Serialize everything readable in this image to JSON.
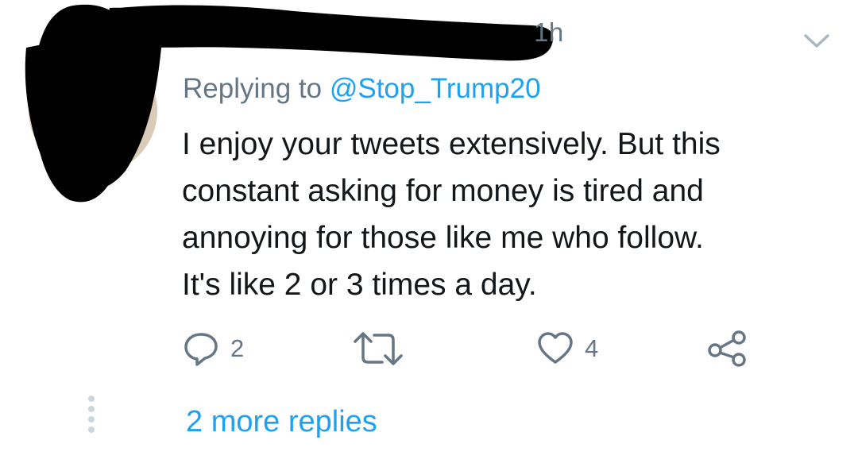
{
  "tweet": {
    "timestamp": "1h",
    "reply_prefix": "Replying to ",
    "reply_handle": "@Stop_Trump20",
    "body_lines": [
      "I enjoy your tweets extensively. But this",
      "constant asking for money is tired and",
      "annoying for those like me who follow.",
      "It's like 2 or 3 times a day."
    ],
    "actions": {
      "reply": {
        "icon": "reply-icon",
        "count": "2"
      },
      "retweet": {
        "icon": "retweet-icon",
        "count": ""
      },
      "like": {
        "icon": "heart-icon",
        "count": "4"
      },
      "share": {
        "icon": "share-icon"
      }
    },
    "menu_icon": "chevron-down-icon"
  },
  "thread": {
    "more_replies": "2 more replies"
  },
  "colors": {
    "secondary_text": "#657786",
    "link": "#1da1f2",
    "primary_text": "#14171a",
    "redaction": "#000000"
  }
}
